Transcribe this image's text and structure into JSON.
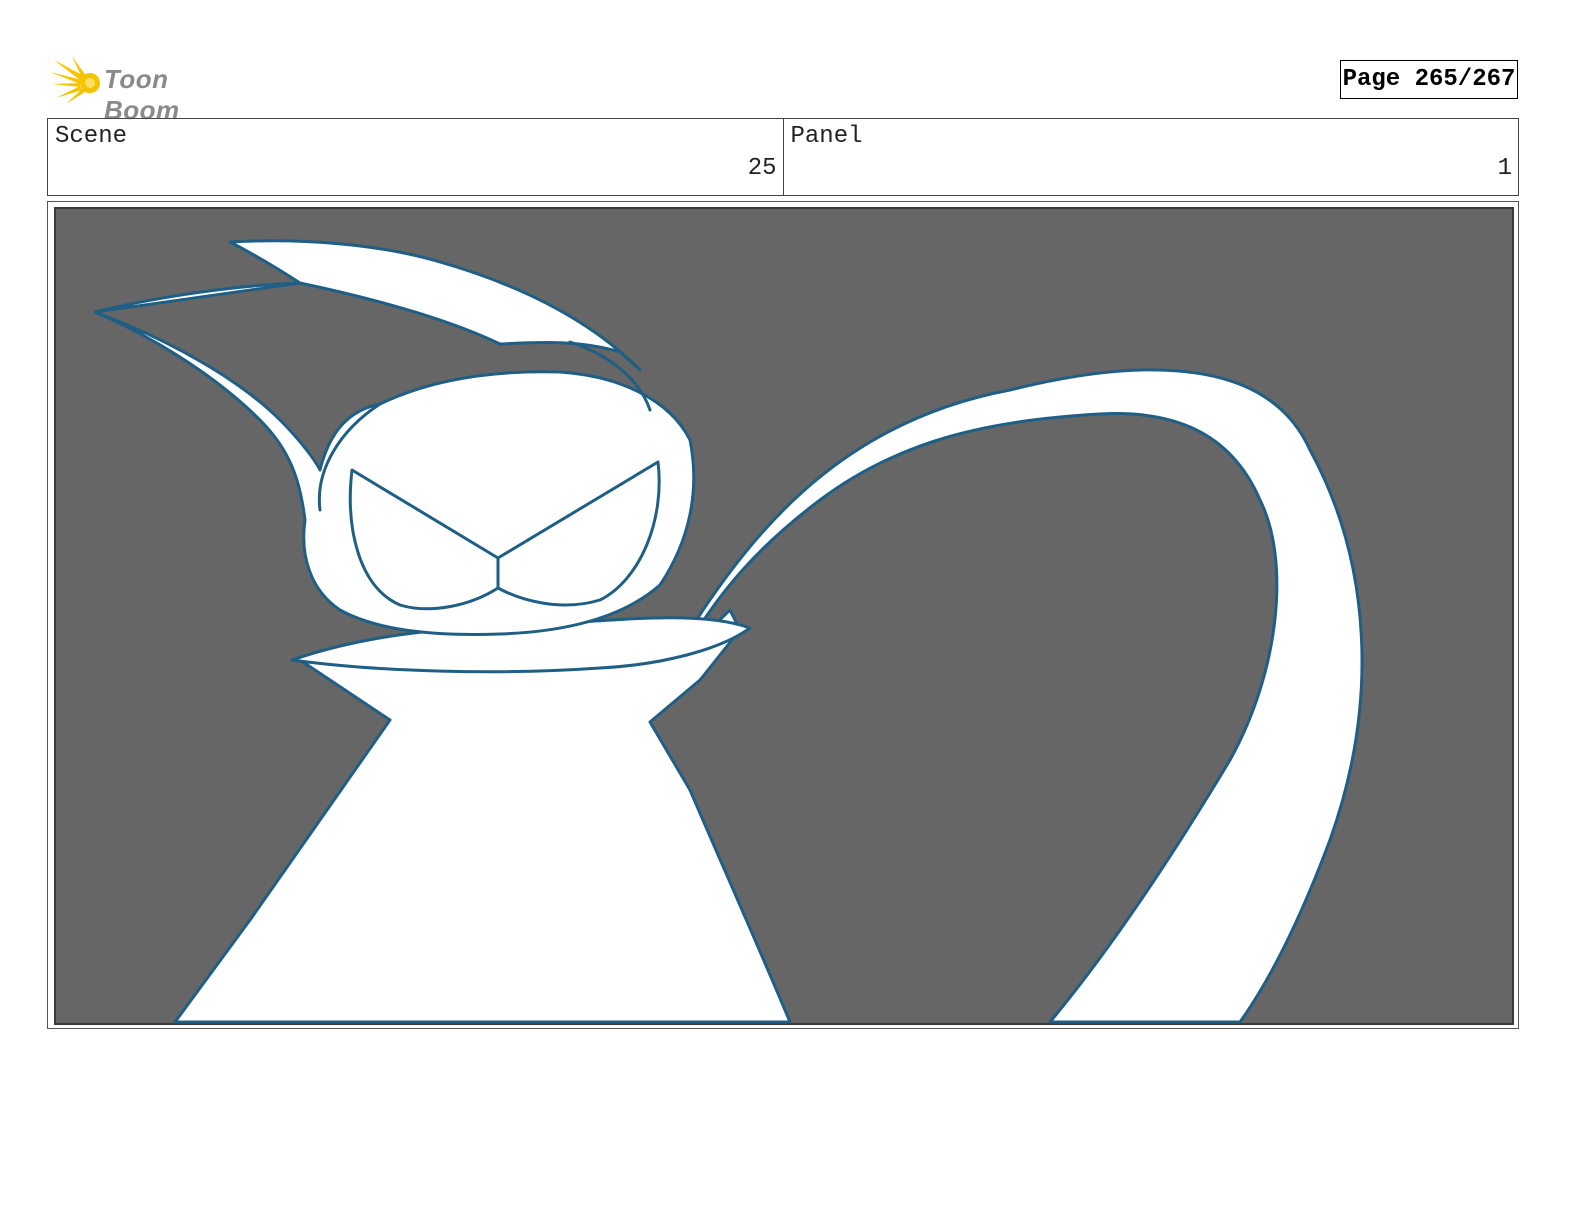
{
  "header": {
    "logo_text": "Toon Boom",
    "page_indicator": "Page 265/267"
  },
  "info": {
    "scene_label": "Scene",
    "scene_value": "25",
    "panel_label": "Panel",
    "panel_value": "1"
  },
  "colors": {
    "panel_background": "#666666",
    "line_art": "#1f5f86",
    "logo_sun": "#f5c400"
  }
}
